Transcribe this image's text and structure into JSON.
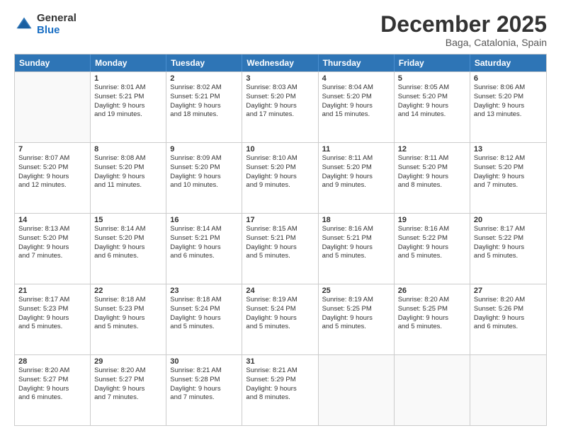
{
  "header": {
    "logo_general": "General",
    "logo_blue": "Blue",
    "month_title": "December 2025",
    "location": "Baga, Catalonia, Spain"
  },
  "weekdays": [
    "Sunday",
    "Monday",
    "Tuesday",
    "Wednesday",
    "Thursday",
    "Friday",
    "Saturday"
  ],
  "rows": [
    [
      {
        "day": "",
        "lines": []
      },
      {
        "day": "1",
        "lines": [
          "Sunrise: 8:01 AM",
          "Sunset: 5:21 PM",
          "Daylight: 9 hours",
          "and 19 minutes."
        ]
      },
      {
        "day": "2",
        "lines": [
          "Sunrise: 8:02 AM",
          "Sunset: 5:21 PM",
          "Daylight: 9 hours",
          "and 18 minutes."
        ]
      },
      {
        "day": "3",
        "lines": [
          "Sunrise: 8:03 AM",
          "Sunset: 5:20 PM",
          "Daylight: 9 hours",
          "and 17 minutes."
        ]
      },
      {
        "day": "4",
        "lines": [
          "Sunrise: 8:04 AM",
          "Sunset: 5:20 PM",
          "Daylight: 9 hours",
          "and 15 minutes."
        ]
      },
      {
        "day": "5",
        "lines": [
          "Sunrise: 8:05 AM",
          "Sunset: 5:20 PM",
          "Daylight: 9 hours",
          "and 14 minutes."
        ]
      },
      {
        "day": "6",
        "lines": [
          "Sunrise: 8:06 AM",
          "Sunset: 5:20 PM",
          "Daylight: 9 hours",
          "and 13 minutes."
        ]
      }
    ],
    [
      {
        "day": "7",
        "lines": [
          "Sunrise: 8:07 AM",
          "Sunset: 5:20 PM",
          "Daylight: 9 hours",
          "and 12 minutes."
        ]
      },
      {
        "day": "8",
        "lines": [
          "Sunrise: 8:08 AM",
          "Sunset: 5:20 PM",
          "Daylight: 9 hours",
          "and 11 minutes."
        ]
      },
      {
        "day": "9",
        "lines": [
          "Sunrise: 8:09 AM",
          "Sunset: 5:20 PM",
          "Daylight: 9 hours",
          "and 10 minutes."
        ]
      },
      {
        "day": "10",
        "lines": [
          "Sunrise: 8:10 AM",
          "Sunset: 5:20 PM",
          "Daylight: 9 hours",
          "and 9 minutes."
        ]
      },
      {
        "day": "11",
        "lines": [
          "Sunrise: 8:11 AM",
          "Sunset: 5:20 PM",
          "Daylight: 9 hours",
          "and 9 minutes."
        ]
      },
      {
        "day": "12",
        "lines": [
          "Sunrise: 8:11 AM",
          "Sunset: 5:20 PM",
          "Daylight: 9 hours",
          "and 8 minutes."
        ]
      },
      {
        "day": "13",
        "lines": [
          "Sunrise: 8:12 AM",
          "Sunset: 5:20 PM",
          "Daylight: 9 hours",
          "and 7 minutes."
        ]
      }
    ],
    [
      {
        "day": "14",
        "lines": [
          "Sunrise: 8:13 AM",
          "Sunset: 5:20 PM",
          "Daylight: 9 hours",
          "and 7 minutes."
        ]
      },
      {
        "day": "15",
        "lines": [
          "Sunrise: 8:14 AM",
          "Sunset: 5:20 PM",
          "Daylight: 9 hours",
          "and 6 minutes."
        ]
      },
      {
        "day": "16",
        "lines": [
          "Sunrise: 8:14 AM",
          "Sunset: 5:21 PM",
          "Daylight: 9 hours",
          "and 6 minutes."
        ]
      },
      {
        "day": "17",
        "lines": [
          "Sunrise: 8:15 AM",
          "Sunset: 5:21 PM",
          "Daylight: 9 hours",
          "and 5 minutes."
        ]
      },
      {
        "day": "18",
        "lines": [
          "Sunrise: 8:16 AM",
          "Sunset: 5:21 PM",
          "Daylight: 9 hours",
          "and 5 minutes."
        ]
      },
      {
        "day": "19",
        "lines": [
          "Sunrise: 8:16 AM",
          "Sunset: 5:22 PM",
          "Daylight: 9 hours",
          "and 5 minutes."
        ]
      },
      {
        "day": "20",
        "lines": [
          "Sunrise: 8:17 AM",
          "Sunset: 5:22 PM",
          "Daylight: 9 hours",
          "and 5 minutes."
        ]
      }
    ],
    [
      {
        "day": "21",
        "lines": [
          "Sunrise: 8:17 AM",
          "Sunset: 5:23 PM",
          "Daylight: 9 hours",
          "and 5 minutes."
        ]
      },
      {
        "day": "22",
        "lines": [
          "Sunrise: 8:18 AM",
          "Sunset: 5:23 PM",
          "Daylight: 9 hours",
          "and 5 minutes."
        ]
      },
      {
        "day": "23",
        "lines": [
          "Sunrise: 8:18 AM",
          "Sunset: 5:24 PM",
          "Daylight: 9 hours",
          "and 5 minutes."
        ]
      },
      {
        "day": "24",
        "lines": [
          "Sunrise: 8:19 AM",
          "Sunset: 5:24 PM",
          "Daylight: 9 hours",
          "and 5 minutes."
        ]
      },
      {
        "day": "25",
        "lines": [
          "Sunrise: 8:19 AM",
          "Sunset: 5:25 PM",
          "Daylight: 9 hours",
          "and 5 minutes."
        ]
      },
      {
        "day": "26",
        "lines": [
          "Sunrise: 8:20 AM",
          "Sunset: 5:25 PM",
          "Daylight: 9 hours",
          "and 5 minutes."
        ]
      },
      {
        "day": "27",
        "lines": [
          "Sunrise: 8:20 AM",
          "Sunset: 5:26 PM",
          "Daylight: 9 hours",
          "and 6 minutes."
        ]
      }
    ],
    [
      {
        "day": "28",
        "lines": [
          "Sunrise: 8:20 AM",
          "Sunset: 5:27 PM",
          "Daylight: 9 hours",
          "and 6 minutes."
        ]
      },
      {
        "day": "29",
        "lines": [
          "Sunrise: 8:20 AM",
          "Sunset: 5:27 PM",
          "Daylight: 9 hours",
          "and 7 minutes."
        ]
      },
      {
        "day": "30",
        "lines": [
          "Sunrise: 8:21 AM",
          "Sunset: 5:28 PM",
          "Daylight: 9 hours",
          "and 7 minutes."
        ]
      },
      {
        "day": "31",
        "lines": [
          "Sunrise: 8:21 AM",
          "Sunset: 5:29 PM",
          "Daylight: 9 hours",
          "and 8 minutes."
        ]
      },
      {
        "day": "",
        "lines": []
      },
      {
        "day": "",
        "lines": []
      },
      {
        "day": "",
        "lines": []
      }
    ]
  ]
}
